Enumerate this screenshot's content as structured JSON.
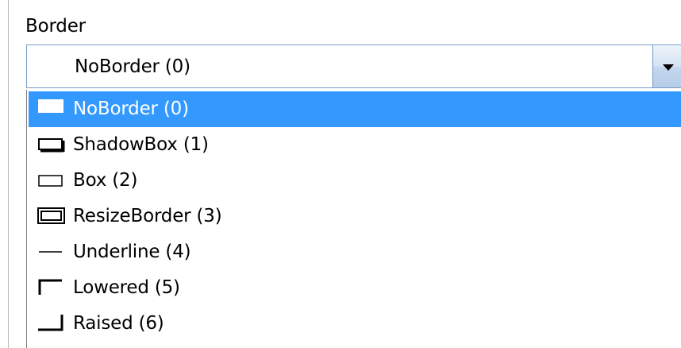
{
  "border": {
    "label": "Border",
    "selected_value": "NoBorder (0)",
    "options": [
      {
        "label": "NoBorder (0)",
        "icon": "no-border-icon",
        "selected": true
      },
      {
        "label": "ShadowBox (1)",
        "icon": "shadow-box-icon",
        "selected": false
      },
      {
        "label": "Box (2)",
        "icon": "box-icon",
        "selected": false
      },
      {
        "label": "ResizeBorder (3)",
        "icon": "resize-border-icon",
        "selected": false
      },
      {
        "label": "Underline (4)",
        "icon": "underline-icon",
        "selected": false
      },
      {
        "label": "Lowered (5)",
        "icon": "lowered-icon",
        "selected": false
      },
      {
        "label": "Raised (6)",
        "icon": "raised-icon",
        "selected": false
      }
    ]
  },
  "colors": {
    "selection": "#3399ff",
    "combo_border": "#7a9cc8"
  }
}
